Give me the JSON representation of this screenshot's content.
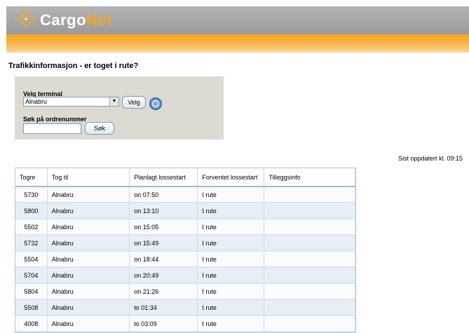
{
  "header": {
    "logo_cargo": "Cargo",
    "logo_net": "Net"
  },
  "page": {
    "title": "Trafikkinformasjon - er toget i rute?"
  },
  "form": {
    "terminal_label": "Velg terminal",
    "terminal_selected": "Alnabru",
    "velg_button": "Velg",
    "order_label": "Søk på ordrenummer",
    "order_value": "",
    "search_button": "Søk"
  },
  "status": {
    "last_updated": "Sist oppdatert kl. 09:15"
  },
  "table": {
    "columns": [
      "Tognr",
      "Tog til",
      "Planlagt lossestart",
      "Forventet lossestart",
      "Tilleggsinfo"
    ],
    "rows": [
      {
        "tognr": "5730",
        "til": "Alnabru",
        "planlagt": "on 07:50",
        "forventet": "I rute",
        "info": ""
      },
      {
        "tognr": "5800",
        "til": "Alnabru",
        "planlagt": "on 13:10",
        "forventet": "I rute",
        "info": ""
      },
      {
        "tognr": "5502",
        "til": "Alnabru",
        "planlagt": "on 15:05",
        "forventet": "I rute",
        "info": ""
      },
      {
        "tognr": "5732",
        "til": "Alnabru",
        "planlagt": "on 15:49",
        "forventet": "I rute",
        "info": ""
      },
      {
        "tognr": "5504",
        "til": "Alnabru",
        "planlagt": "on 18:44",
        "forventet": "I rute",
        "info": ""
      },
      {
        "tognr": "5704",
        "til": "Alnabru",
        "planlagt": "on 20:49",
        "forventet": "I rute",
        "info": ""
      },
      {
        "tognr": "5804",
        "til": "Alnabru",
        "planlagt": "on 21:26",
        "forventet": "I rute",
        "info": ""
      },
      {
        "tognr": "5508",
        "til": "Alnabru",
        "planlagt": "to 01:34",
        "forventet": "I rute",
        "info": ""
      },
      {
        "tognr": "4008",
        "til": "Alnabru",
        "planlagt": "to 03:09",
        "forventet": "I rute",
        "info": ""
      }
    ]
  },
  "colors": {
    "brand_orange": "#f5a623",
    "header_gray": "#a8a8a8",
    "panel_bg": "#dcdad2",
    "row_alt": "#e8eef6"
  },
  "icons": {
    "logo": "cargonet-diamond-logo-icon",
    "refresh": "refresh-icon",
    "dropdown": "chevron-down-icon"
  }
}
